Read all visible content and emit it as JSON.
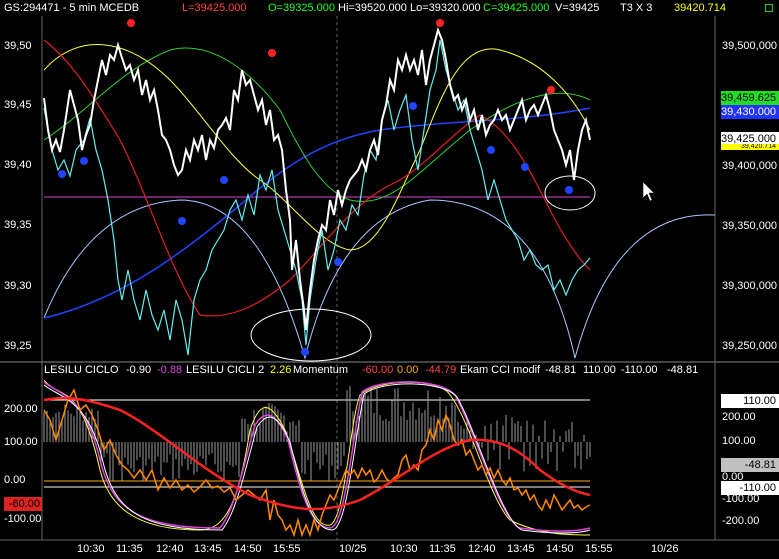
{
  "header": {
    "symbol": "GS:294471 - 5 min  MCEDB",
    "low": "L=39425.000",
    "open": "O=39325.000",
    "high": "Hi=39520.000",
    "lo": "Lo=39320.000",
    "close": "C=39425.000",
    "volume": "V=39425",
    "study": "T3 X 3",
    "value": "39420.714"
  },
  "price_axis": {
    "ticks": [
      "39,50",
      "39,45",
      "39,40",
      "39,35",
      "39,30",
      "39,25"
    ],
    "right_ticks": [
      "39,500,000",
      "39,400,000",
      "39,350,000",
      "39,300,000",
      "39,250,000"
    ],
    "badges": [
      {
        "text": "39,459.625",
        "bg": "#22dd22",
        "fg": "#000000"
      },
      {
        "text": "39,430.000",
        "bg": "#2233ff",
        "fg": "#ffffff"
      },
      {
        "text": "39,425.000",
        "bg": "#ffffff",
        "fg": "#000000"
      },
      {
        "text": "39,420.714",
        "bg": "#ffff00",
        "fg": "#000000"
      }
    ]
  },
  "indicator": {
    "label1": "LESILU CICLO",
    "val1": "-0.90",
    "val1b": "-0.88",
    "label2": "LESILU CICLI 2",
    "val2": "2.26",
    "label3": "Momentum",
    "val3a": "-60.00",
    "val3b": "0.00",
    "val3c": "-44.79",
    "label4": "Ekam CCI modif",
    "val4": "-48.81",
    "val5": "110.00",
    "val6": "-110.00",
    "val7": "-48.81",
    "left_ticks": [
      "200.00",
      "100.00",
      "0.00",
      "-100.00"
    ],
    "left_badge": "-60.00",
    "right_ticks": [
      "200.00",
      "100.00",
      "0.00",
      "-100.00",
      "-200.00"
    ],
    "badges": [
      {
        "text": "110.00",
        "bg": "#ffffff",
        "fg": "#000000"
      },
      {
        "text": "-48.81",
        "bg": "#c0c0c0",
        "fg": "#000000"
      },
      {
        "text": "-110.00",
        "bg": "#ffffff",
        "fg": "#000000"
      }
    ]
  },
  "time_axis": [
    "10:30",
    "11:35",
    "12:40",
    "13:45",
    "14:50",
    "15:55",
    "10/25",
    "10:30",
    "11:35",
    "12:40",
    "13:45",
    "14:50",
    "15:55",
    "10/26"
  ],
  "colors": {
    "price": "#ffffff",
    "cyan": "#66eeee",
    "red": "#dd2222",
    "yellow": "#ffff44",
    "green": "#33cc33",
    "blue": "#2244ff",
    "magenta": "#dd44dd",
    "orange": "#ff8800"
  }
}
